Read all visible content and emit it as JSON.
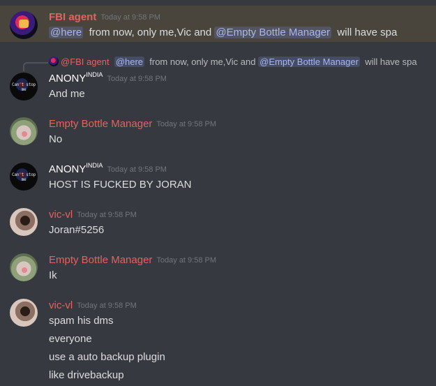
{
  "messages": [
    {
      "author": "FBI agent",
      "timestamp": "Today at 9:58 PM",
      "parts": [
        "@here",
        "from now, only me,Vic and",
        "@Empty Bottle Manager",
        "will have spa"
      ]
    },
    {
      "reply": {
        "author": "@FBI agent",
        "parts": [
          "@here",
          "from now, only me,Vic and",
          "@Empty Bottle Manager",
          "will have spa"
        ]
      },
      "author": "ANONY",
      "author_sup": "INDIA",
      "timestamp": "Today at 9:58 PM",
      "text": "And me",
      "avatar_text": "Can't stop me"
    },
    {
      "author": "Empty Bottle Manager",
      "timestamp": "Today at 9:58 PM",
      "text": "No"
    },
    {
      "author": "ANONY",
      "author_sup": "INDIA",
      "timestamp": "Today at 9:58 PM",
      "text": "HOST IS FUCKED BY JORAN",
      "avatar_text": "Can't stop me"
    },
    {
      "author": "vic-vl",
      "timestamp": "Today at 9:58 PM",
      "text": "Joran#5256"
    },
    {
      "author": "Empty Bottle Manager",
      "timestamp": "Today at 9:58 PM",
      "text": "Ik"
    },
    {
      "author": "vic-vl",
      "timestamp": "Today at 9:58 PM",
      "lines": [
        "spam his dms",
        "everyone",
        "use a auto backup plugin",
        "like drivebackup"
      ]
    }
  ],
  "colors": {
    "background": "#36393f",
    "highlight": "#49443c",
    "username_red": "#e06461",
    "mention_text": "#a9b6ec"
  }
}
